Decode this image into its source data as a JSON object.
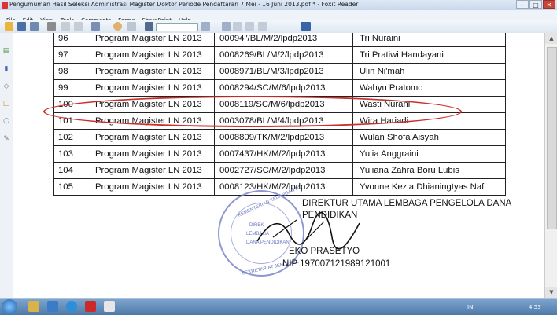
{
  "window": {
    "title": "Pengumuman Hasil Seleksi Administrasi Magister Doktor Periode Pendaftaran 7 Mei - 16 Juni 2013.pdf * - Foxit Reader",
    "minimize": "–",
    "maximize": "□",
    "close": "✕"
  },
  "menu": [
    "File",
    "Edit",
    "View",
    "Tools",
    "Comments",
    "Forms",
    "SharePoint",
    "Help"
  ],
  "toolbar_icons": [
    "open-icon",
    "save-icon",
    "print-icon",
    "copy-icon",
    "hand-icon",
    "select-icon",
    "zoom-icon",
    "search-field",
    "page-icon",
    "export-icon"
  ],
  "sidebar_icons": [
    "pages-icon",
    "bookmark-icon",
    "attachment-icon",
    "comment-icon",
    "layers-icon",
    "signature-icon"
  ],
  "table": {
    "rows": [
      {
        "no": "96",
        "program": "Program Magister LN 2013",
        "code": "00094′′/BL/M/2/lpdp2013",
        "name": "Tri Nuraini"
      },
      {
        "no": "97",
        "program": "Program Magister LN 2013",
        "code": "0008269/BL/M/2/lpdp2013",
        "name": "Tri Pratiwi Handayani"
      },
      {
        "no": "98",
        "program": "Program Magister LN 2013",
        "code": "0008971/BL/M/3/lpdp2013",
        "name": "Ulin Ni'mah"
      },
      {
        "no": "99",
        "program": "Program Magister LN 2013",
        "code": "0008294/SC/M/6/lpdp2013",
        "name": "Wahyu Pratomo"
      },
      {
        "no": "100",
        "program": "Program Magister LN 2013",
        "code": "0008119/SC/M/6/lpdp2013",
        "name": "Wasti Nurani"
      },
      {
        "no": "101",
        "program": "Program Magister LN 2013",
        "code": "0003078/BL/M/4/lpdp2013",
        "name": "Wira Hariadi"
      },
      {
        "no": "102",
        "program": "Program Magister LN 2013",
        "code": "0008809/TK/M/2/lpdp2013",
        "name": "Wulan Shofa Aisyah"
      },
      {
        "no": "103",
        "program": "Program Magister LN 2013",
        "code": "0007437/HK/M/2/lpdp2013",
        "name": "Yulia Anggraini"
      },
      {
        "no": "104",
        "program": "Program Magister LN 2013",
        "code": "0002727/SC/M/2/lpdp2013",
        "name": "Yuliana Zahra Boru Lubis"
      },
      {
        "no": "105",
        "program": "Program Magister LN 2013",
        "code": "0008123/HK/M/2/lpdp2013",
        "name": "Yvonne Kezia Dhianingtyas Nafi"
      }
    ],
    "highlighted_row": "101",
    "highlight_color": "#c9302c"
  },
  "signature": {
    "line1": "DIREKTUR UTAMA LEMBAGA PENGELOLA DANA",
    "line2": "PENDIDIKAN",
    "name": "EKO PRASETYO",
    "nip": "NIP 197007121989121001",
    "stamp_top": "KEMENTERIAN KEUANGAN RI",
    "stamp_center1": "DIREK",
    "stamp_center2": "LEMBAGA",
    "stamp_center3": "DANA PENDIDIKAN",
    "stamp_bottom": "SEKRETARIAT JENDERAL",
    "stamp_color": "#6b77c0"
  },
  "taskbar": {
    "lang": "IN",
    "time": "4:53"
  }
}
